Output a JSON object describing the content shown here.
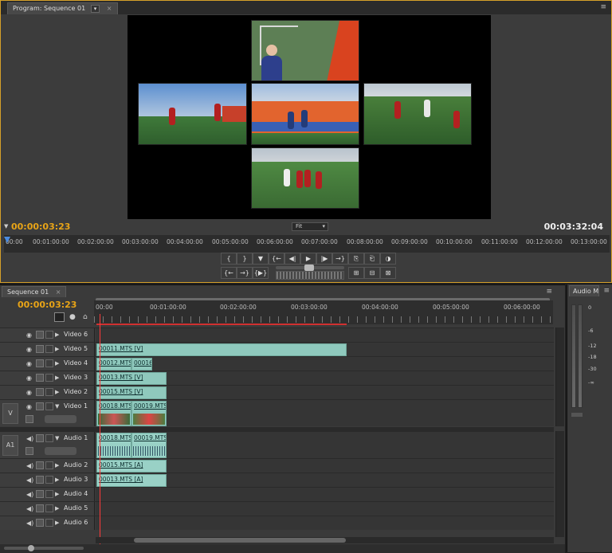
{
  "program": {
    "tab_label": "Program: Sequence 01",
    "current_time": "00:00:03:23",
    "duration": "00:03:32:04",
    "fit_label": "Fit",
    "ruler_ticks": [
      "00:00",
      "00:01:00:00",
      "00:02:00:00",
      "00:03:00:00",
      "00:04:00:00",
      "00:05:00:00",
      "00:06:00:00",
      "00:07:00:00",
      "00:08:00:00",
      "00:09:00:00",
      "00:10:00:00",
      "00:11:00:00",
      "00:12:00:00",
      "00:13:00:00"
    ]
  },
  "controls": {
    "row1": [
      "{",
      "}",
      "▼",
      "{←",
      "◀|",
      "▶",
      "|▶",
      "→}",
      "⎘",
      "⎗",
      "◑"
    ],
    "row2": [
      "{←",
      "→}",
      "{▶}",
      "⊞",
      "⊟",
      "⊠"
    ]
  },
  "sequence": {
    "tab_label": "Sequence 01",
    "current_time": "00:00:03:23",
    "ruler_ticks": [
      "00:00",
      "00:01:00:00",
      "00:02:00:00",
      "00:03:00:00",
      "00:04:00:00",
      "00:05:00:00",
      "00:06:00:00"
    ],
    "video_tracks": [
      {
        "name": "Video 6",
        "clips": []
      },
      {
        "name": "Video 5",
        "clips": [
          {
            "label": "00011.MTS [V]"
          }
        ]
      },
      {
        "name": "Video 4",
        "clips": [
          {
            "label": "00012.MTS"
          },
          {
            "label": "00016"
          }
        ]
      },
      {
        "name": "Video 3",
        "clips": [
          {
            "label": "00013.MTS [V]"
          }
        ]
      },
      {
        "name": "Video 2",
        "clips": [
          {
            "label": "00015.MTS [V]"
          }
        ]
      },
      {
        "name": "Video 1",
        "clips": [
          {
            "label": "00018.MTS"
          },
          {
            "label": "00019.MTS"
          }
        ]
      }
    ],
    "audio_tracks": [
      {
        "name": "Audio 1",
        "clips": [
          {
            "label": "00018.MTS"
          },
          {
            "label": "00019.MTS"
          }
        ]
      },
      {
        "name": "Audio 2",
        "clips": [
          {
            "label": "00015.MTS [A]"
          }
        ]
      },
      {
        "name": "Audio 3",
        "clips": [
          {
            "label": "00013.MTS [A]"
          }
        ]
      },
      {
        "name": "Audio 4",
        "clips": []
      },
      {
        "name": "Audio 5",
        "clips": []
      },
      {
        "name": "Audio 6",
        "clips": []
      }
    ],
    "source_v": "V",
    "source_a": "A1"
  },
  "audio_meter": {
    "tab_label": "Audio M",
    "scale": [
      "0",
      "-6",
      "-12",
      "-18",
      "-30",
      "-∞"
    ]
  }
}
